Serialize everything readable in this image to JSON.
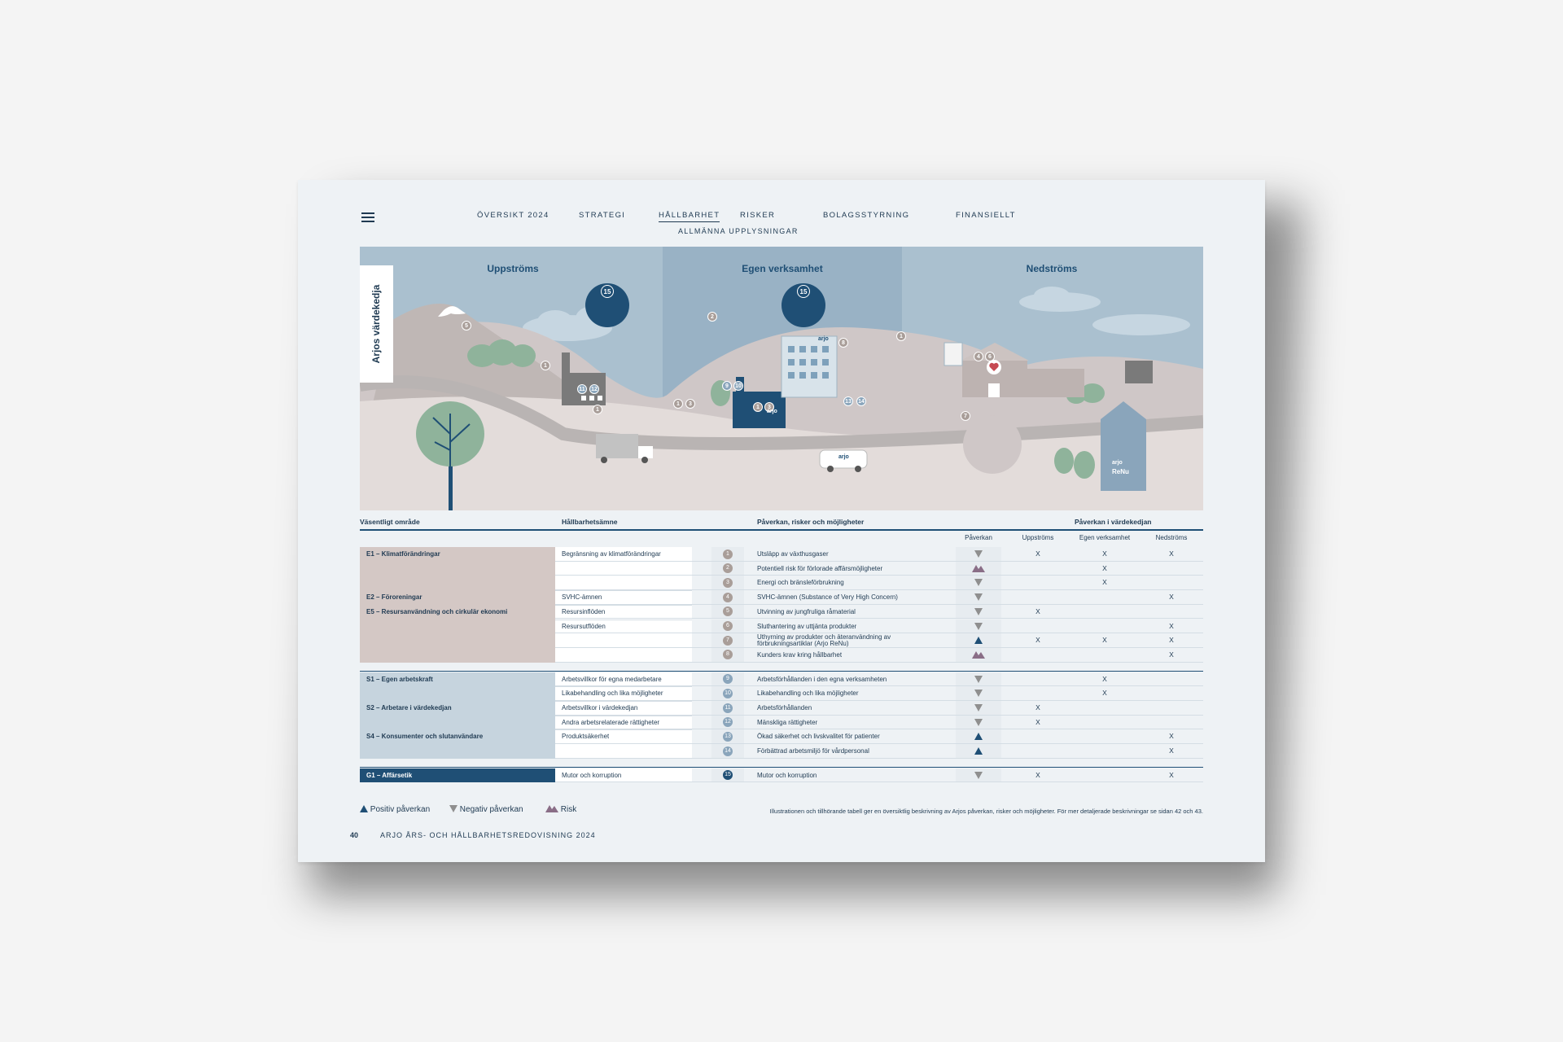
{
  "nav": {
    "items": [
      "ÖVERSIKT 2024",
      "STRATEGI",
      "HÅLLBARHET",
      "RISKER",
      "BOLAGSSTYRNING",
      "FINANSIELLT"
    ],
    "active": "HÅLLBARHET",
    "sub": "ALLMÄNNA UPPLYSNINGAR"
  },
  "illustration": {
    "title": "Arjos värdekedja",
    "zones": [
      "Uppströms",
      "Egen verksamhet",
      "Nedströms"
    ],
    "brand": "arjo",
    "renu": "ReNu",
    "badges": [
      "15",
      "15",
      "5",
      "1",
      "11",
      "12",
      "1",
      "2",
      "1",
      "3",
      "9",
      "10",
      "1",
      "3",
      "8",
      "1",
      "4",
      "6",
      "13",
      "14",
      "7"
    ]
  },
  "table": {
    "headers": {
      "area": "Väsentligt område",
      "topic": "Hållbarhetsämne",
      "impact": "Påverkan, risker och möjligheter",
      "chain": "Påverkan i värdekedjan"
    },
    "subheaders": {
      "effect": "Påverkan",
      "up": "Uppströms",
      "own": "Egen verksamhet",
      "down": "Nedströms"
    },
    "env_areas": [
      "E1 – Klimatförändringar",
      "E2 – Föroreningar",
      "E5 – Resursanvändning och cirkulär ekonomi"
    ],
    "soc_areas": [
      "S1 – Egen arbetskraft",
      "S2 – Arbetare i värdekedjan",
      "S4 – Konsumenter och slutanvändare"
    ],
    "gov_areas": [
      "G1 – Affärsetik"
    ],
    "env_topics": [
      "Begränsning av klimatförändringar",
      "SVHC-ämnen",
      "Resursinflöden",
      "Resursutflöden"
    ],
    "soc_topics": [
      "Arbetsvillkor för egna medarbetare",
      "Likabehandling och lika möjligheter",
      "Arbetsvillkor i värdekedjan",
      "Andra arbetsrelaterade rättigheter",
      "Produktsäkerhet"
    ],
    "gov_topics": [
      "Mutor och korruption"
    ],
    "env_rows": [
      {
        "n": "1",
        "text": "Utsläpp av växthusgaser",
        "effect": "neg",
        "up": "X",
        "own": "X",
        "down": "X"
      },
      {
        "n": "2",
        "text": "Potentiell risk för förlorade affärsmöjligheter",
        "effect": "risk",
        "up": "",
        "own": "X",
        "down": ""
      },
      {
        "n": "3",
        "text": "Energi och bränsleförbrukning",
        "effect": "neg",
        "up": "",
        "own": "X",
        "down": ""
      },
      {
        "n": "4",
        "text": "SVHC-ämnen (Substance of Very High Concern)",
        "effect": "neg",
        "up": "",
        "own": "",
        "down": "X"
      },
      {
        "n": "5",
        "text": "Utvinning av jungfruliga råmaterial",
        "effect": "neg",
        "up": "X",
        "own": "",
        "down": ""
      },
      {
        "n": "6",
        "text": "Sluthantering av uttjänta produkter",
        "effect": "neg",
        "up": "",
        "own": "",
        "down": "X"
      },
      {
        "n": "7",
        "text": "Uthyrning av produkter och återanvändning av",
        "text2": "förbrukningsartiklar (Arjo ReNu)",
        "effect": "pos",
        "up": "X",
        "own": "X",
        "down": "X"
      },
      {
        "n": "8",
        "text": "Kunders krav kring hållbarhet",
        "effect": "risk",
        "up": "",
        "own": "",
        "down": "X"
      }
    ],
    "soc_rows": [
      {
        "n": "9",
        "text": "Arbetsförhållanden i den egna verksamheten",
        "effect": "neg",
        "up": "",
        "own": "X",
        "down": ""
      },
      {
        "n": "10",
        "text": "Likabehandling och lika möjligheter",
        "effect": "neg",
        "up": "",
        "own": "X",
        "down": ""
      },
      {
        "n": "11",
        "text": "Arbetsförhållanden",
        "effect": "neg",
        "up": "X",
        "own": "",
        "down": ""
      },
      {
        "n": "12",
        "text": "Mänskliga rättigheter",
        "effect": "neg",
        "up": "X",
        "own": "",
        "down": ""
      },
      {
        "n": "13",
        "text": "Ökad säkerhet och livskvalitet för patienter",
        "effect": "pos",
        "up": "",
        "own": "",
        "down": "X"
      },
      {
        "n": "14",
        "text": "Förbättrad arbetsmiljö för vårdpersonal",
        "effect": "pos",
        "up": "",
        "own": "",
        "down": "X"
      }
    ],
    "gov_rows": [
      {
        "n": "15",
        "text": "Mutor och korruption",
        "effect": "neg",
        "up": "X",
        "own": "",
        "down": "X"
      }
    ]
  },
  "legend": {
    "positive": "Positiv påverkan",
    "negative": "Negativ påverkan",
    "risk": "Risk"
  },
  "note": "Illustrationen och tillhörande tabell ger en översiktlig beskrivning av Arjos påverkan, risker och möjligheter. För mer detaljerade beskrivningar se sidan 42 och 43.",
  "footer": {
    "page": "40",
    "title": "ARJO ÅRS- OCH HÅLLBARHETSREDOVISNING 2024"
  },
  "colors": {
    "navy": "#1f4f75",
    "env": "#d4c8c5",
    "soc": "#c6d4de",
    "gov": "#1f4f75",
    "risk": "#8a6e87",
    "neg": "#8f8f8f",
    "pos": "#1f4f75",
    "env_badge": "#a99e99",
    "soc_badge": "#8aa5bb"
  }
}
